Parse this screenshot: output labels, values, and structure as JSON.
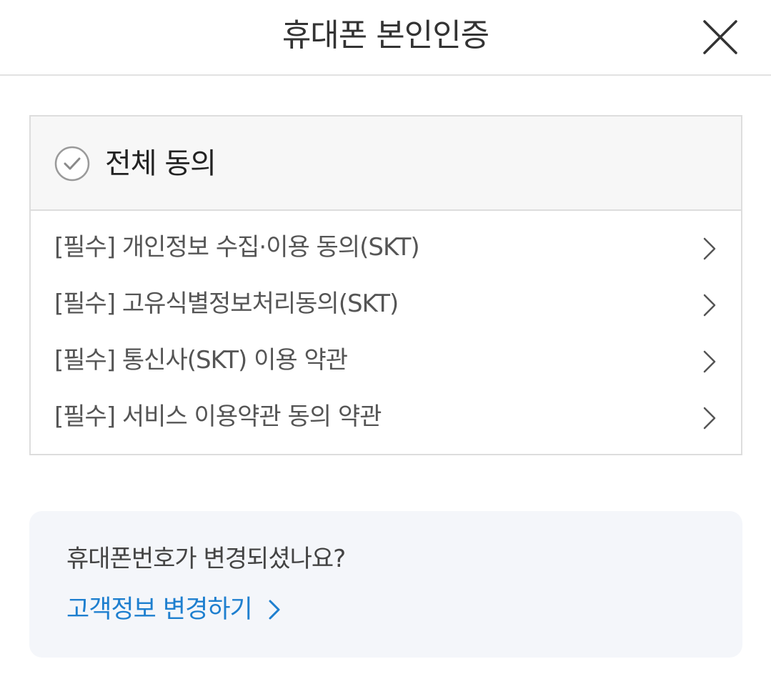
{
  "header": {
    "title": "휴대폰 본인인증",
    "close_icon": "close-icon"
  },
  "terms": {
    "agree_all_label": "전체 동의",
    "agree_all_icon": "check-circle-icon",
    "items": [
      {
        "label": "[필수] 개인정보 수집·이용 동의(SKT)",
        "icon": "chevron-right-icon"
      },
      {
        "label": "[필수] 고유식별정보처리동의(SKT)",
        "icon": "chevron-right-icon"
      },
      {
        "label": "[필수] 통신사(SKT) 이용 약관",
        "icon": "chevron-right-icon"
      },
      {
        "label": "[필수] 서비스 이용약관 동의 약관",
        "icon": "chevron-right-icon"
      }
    ]
  },
  "info": {
    "question": "휴대폰번호가 변경되셨나요?",
    "link_label": "고객정보 변경하기",
    "link_icon": "chevron-right-icon"
  },
  "colors": {
    "link": "#1e7fcf",
    "border": "#dddddd",
    "agree_all_bg": "#f7f7f7",
    "info_bg": "#f4f6fa",
    "text": "#333333"
  }
}
